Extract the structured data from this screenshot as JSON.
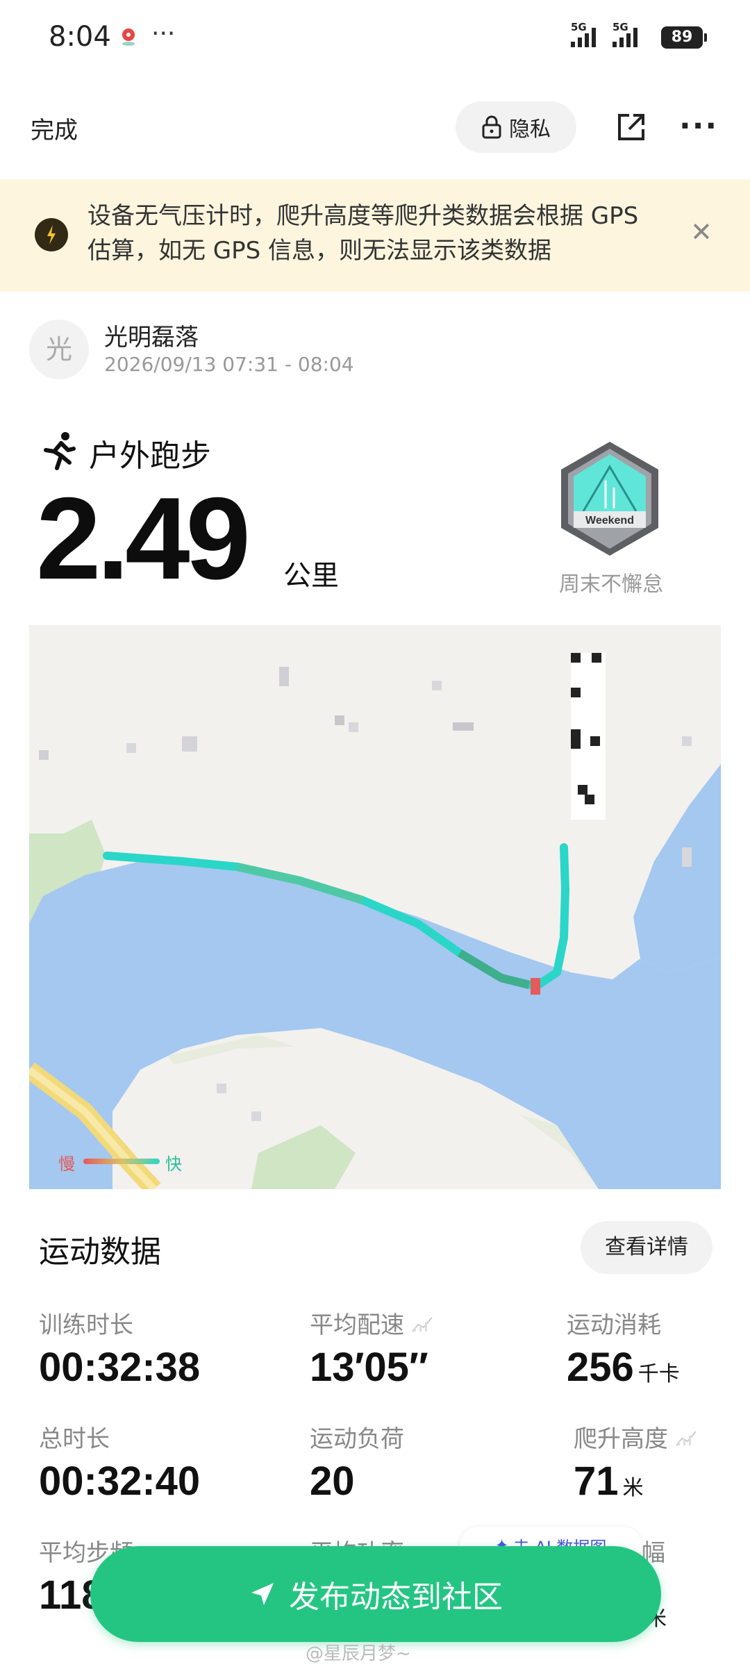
{
  "status_bar": {
    "time": "8:04",
    "more": "···",
    "signal1": "5G",
    "signal2": "5G",
    "battery": "89"
  },
  "topbar": {
    "done_label": "完成",
    "privacy_label": "隐私"
  },
  "notice": {
    "text": "设备无气压计时，爬升高度等爬升类数据会根据 GPS 估算，如无 GPS 信息，则无法显示该类数据"
  },
  "user": {
    "avatar_char": "光",
    "name": "光明磊落",
    "time_range": "2026/09/13 07:31 - 08:04"
  },
  "activity": {
    "type": "户外跑步",
    "distance": "2.49",
    "distance_unit": "公里",
    "badge_text": "Weekend",
    "badge_label": "周末不懈怠"
  },
  "map": {
    "legend_slow": "慢",
    "legend_fast": "快",
    "colors": {
      "water": "#a4c8ef",
      "land": "#f3f1ee",
      "park": "#cfe5c4",
      "route_fast": "#2ad6c8",
      "route_slow": "#e55a5a"
    }
  },
  "stats_section": {
    "title": "运动数据",
    "details_label": "查看详情",
    "items": [
      {
        "label": "训练时长",
        "value": "00:32:38",
        "unit": ""
      },
      {
        "label": "平均配速",
        "value": "13′05″",
        "unit": ""
      },
      {
        "label": "运动消耗",
        "value": "256",
        "unit": "千卡"
      },
      {
        "label": "总时长",
        "value": "00:32:40",
        "unit": ""
      },
      {
        "label": "运动负荷",
        "value": "20",
        "unit": ""
      },
      {
        "label": "爬升高度",
        "value": "71",
        "unit": "米"
      },
      {
        "label": "平均步频",
        "value": "118",
        "unit": ""
      },
      {
        "label": "平均功率",
        "value": "",
        "unit": ""
      },
      {
        "label": "幅",
        "value": "",
        "unit": "米"
      }
    ]
  },
  "ai_chip": {
    "label": "去 AI 数据图"
  },
  "publish": {
    "label": "发布动态到社区"
  },
  "watermark": "@星辰月梦~"
}
